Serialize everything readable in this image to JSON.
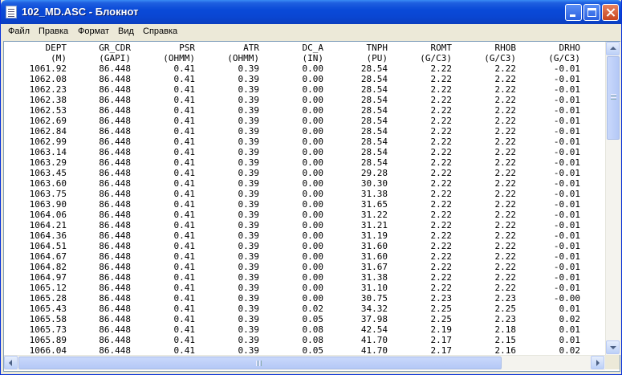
{
  "window": {
    "title": "102_MD.ASC - Блокнот",
    "icons": {
      "app": "notepad-icon",
      "minimize": "minimize-icon",
      "maximize": "maximize-icon",
      "close": "close-icon"
    }
  },
  "menu": {
    "items": [
      "Файл",
      "Правка",
      "Формат",
      "Вид",
      "Справка"
    ]
  },
  "table": {
    "headers": [
      "DEPT",
      "GR_CDR",
      "PSR",
      "ATR",
      "DC_A",
      "TNPH",
      "ROMT",
      "RHOB",
      "DRHO"
    ],
    "units": [
      "(M)",
      "(GAPI)",
      "(OHMM)",
      "(OHMM)",
      "(IN)",
      "(PU)",
      "(G/C3)",
      "(G/C3)",
      "(G/C3)"
    ],
    "rows": [
      [
        "1061.92",
        "86.448",
        "0.41",
        "0.39",
        "0.00",
        "28.54",
        "2.22",
        "2.22",
        "-0.01"
      ],
      [
        "1062.08",
        "86.448",
        "0.41",
        "0.39",
        "0.00",
        "28.54",
        "2.22",
        "2.22",
        "-0.01"
      ],
      [
        "1062.23",
        "86.448",
        "0.41",
        "0.39",
        "0.00",
        "28.54",
        "2.22",
        "2.22",
        "-0.01"
      ],
      [
        "1062.38",
        "86.448",
        "0.41",
        "0.39",
        "0.00",
        "28.54",
        "2.22",
        "2.22",
        "-0.01"
      ],
      [
        "1062.53",
        "86.448",
        "0.41",
        "0.39",
        "0.00",
        "28.54",
        "2.22",
        "2.22",
        "-0.01"
      ],
      [
        "1062.69",
        "86.448",
        "0.41",
        "0.39",
        "0.00",
        "28.54",
        "2.22",
        "2.22",
        "-0.01"
      ],
      [
        "1062.84",
        "86.448",
        "0.41",
        "0.39",
        "0.00",
        "28.54",
        "2.22",
        "2.22",
        "-0.01"
      ],
      [
        "1062.99",
        "86.448",
        "0.41",
        "0.39",
        "0.00",
        "28.54",
        "2.22",
        "2.22",
        "-0.01"
      ],
      [
        "1063.14",
        "86.448",
        "0.41",
        "0.39",
        "0.00",
        "28.54",
        "2.22",
        "2.22",
        "-0.01"
      ],
      [
        "1063.29",
        "86.448",
        "0.41",
        "0.39",
        "0.00",
        "28.54",
        "2.22",
        "2.22",
        "-0.01"
      ],
      [
        "1063.45",
        "86.448",
        "0.41",
        "0.39",
        "0.00",
        "29.28",
        "2.22",
        "2.22",
        "-0.01"
      ],
      [
        "1063.60",
        "86.448",
        "0.41",
        "0.39",
        "0.00",
        "30.30",
        "2.22",
        "2.22",
        "-0.01"
      ],
      [
        "1063.75",
        "86.448",
        "0.41",
        "0.39",
        "0.00",
        "31.38",
        "2.22",
        "2.22",
        "-0.01"
      ],
      [
        "1063.90",
        "86.448",
        "0.41",
        "0.39",
        "0.00",
        "31.65",
        "2.22",
        "2.22",
        "-0.01"
      ],
      [
        "1064.06",
        "86.448",
        "0.41",
        "0.39",
        "0.00",
        "31.22",
        "2.22",
        "2.22",
        "-0.01"
      ],
      [
        "1064.21",
        "86.448",
        "0.41",
        "0.39",
        "0.00",
        "31.21",
        "2.22",
        "2.22",
        "-0.01"
      ],
      [
        "1064.36",
        "86.448",
        "0.41",
        "0.39",
        "0.00",
        "31.19",
        "2.22",
        "2.22",
        "-0.01"
      ],
      [
        "1064.51",
        "86.448",
        "0.41",
        "0.39",
        "0.00",
        "31.60",
        "2.22",
        "2.22",
        "-0.01"
      ],
      [
        "1064.67",
        "86.448",
        "0.41",
        "0.39",
        "0.00",
        "31.60",
        "2.22",
        "2.22",
        "-0.01"
      ],
      [
        "1064.82",
        "86.448",
        "0.41",
        "0.39",
        "0.00",
        "31.67",
        "2.22",
        "2.22",
        "-0.01"
      ],
      [
        "1064.97",
        "86.448",
        "0.41",
        "0.39",
        "0.00",
        "31.38",
        "2.22",
        "2.22",
        "-0.01"
      ],
      [
        "1065.12",
        "86.448",
        "0.41",
        "0.39",
        "0.00",
        "31.10",
        "2.22",
        "2.22",
        "-0.01"
      ],
      [
        "1065.28",
        "86.448",
        "0.41",
        "0.39",
        "0.00",
        "30.75",
        "2.23",
        "2.23",
        "-0.00"
      ],
      [
        "1065.43",
        "86.448",
        "0.41",
        "0.39",
        "0.02",
        "34.32",
        "2.25",
        "2.25",
        "0.01"
      ],
      [
        "1065.58",
        "86.448",
        "0.41",
        "0.39",
        "0.05",
        "37.98",
        "2.25",
        "2.23",
        "0.02"
      ],
      [
        "1065.73",
        "86.448",
        "0.41",
        "0.39",
        "0.08",
        "42.54",
        "2.19",
        "2.18",
        "0.01"
      ],
      [
        "1065.89",
        "86.448",
        "0.41",
        "0.39",
        "0.08",
        "41.70",
        "2.17",
        "2.15",
        "0.01"
      ],
      [
        "1066.04",
        "86.448",
        "0.41",
        "0.39",
        "0.05",
        "41.70",
        "2.17",
        "2.16",
        "0.02"
      ]
    ]
  }
}
